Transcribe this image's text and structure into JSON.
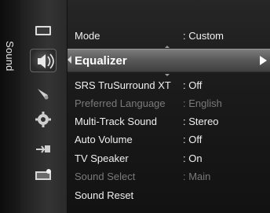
{
  "sidebar": {
    "category_label": "Sound"
  },
  "icons": [
    {
      "name": "picture-icon",
      "active": false
    },
    {
      "name": "sound-icon",
      "active": true
    },
    {
      "name": "channel-icon",
      "active": false
    },
    {
      "name": "setup-icon",
      "active": false
    },
    {
      "name": "input-icon",
      "active": false
    },
    {
      "name": "application-icon",
      "active": false
    }
  ],
  "menu": {
    "mode": {
      "label": "Mode",
      "value": ": Custom"
    },
    "equalizer": {
      "label": "Equalizer"
    },
    "srs": {
      "label": "SRS TruSurround XT",
      "value": ": Off"
    },
    "preferred_language": {
      "label": "Preferred Language",
      "value": ": English"
    },
    "multi_track": {
      "label": "Multi-Track Sound",
      "value": ": Stereo"
    },
    "auto_volume": {
      "label": "Auto Volume",
      "value": ": Off"
    },
    "tv_speaker": {
      "label": "TV Speaker",
      "value": ": On"
    },
    "sound_select": {
      "label": "Sound Select",
      "value": ": Main"
    },
    "sound_reset": {
      "label": "Sound Reset"
    }
  }
}
